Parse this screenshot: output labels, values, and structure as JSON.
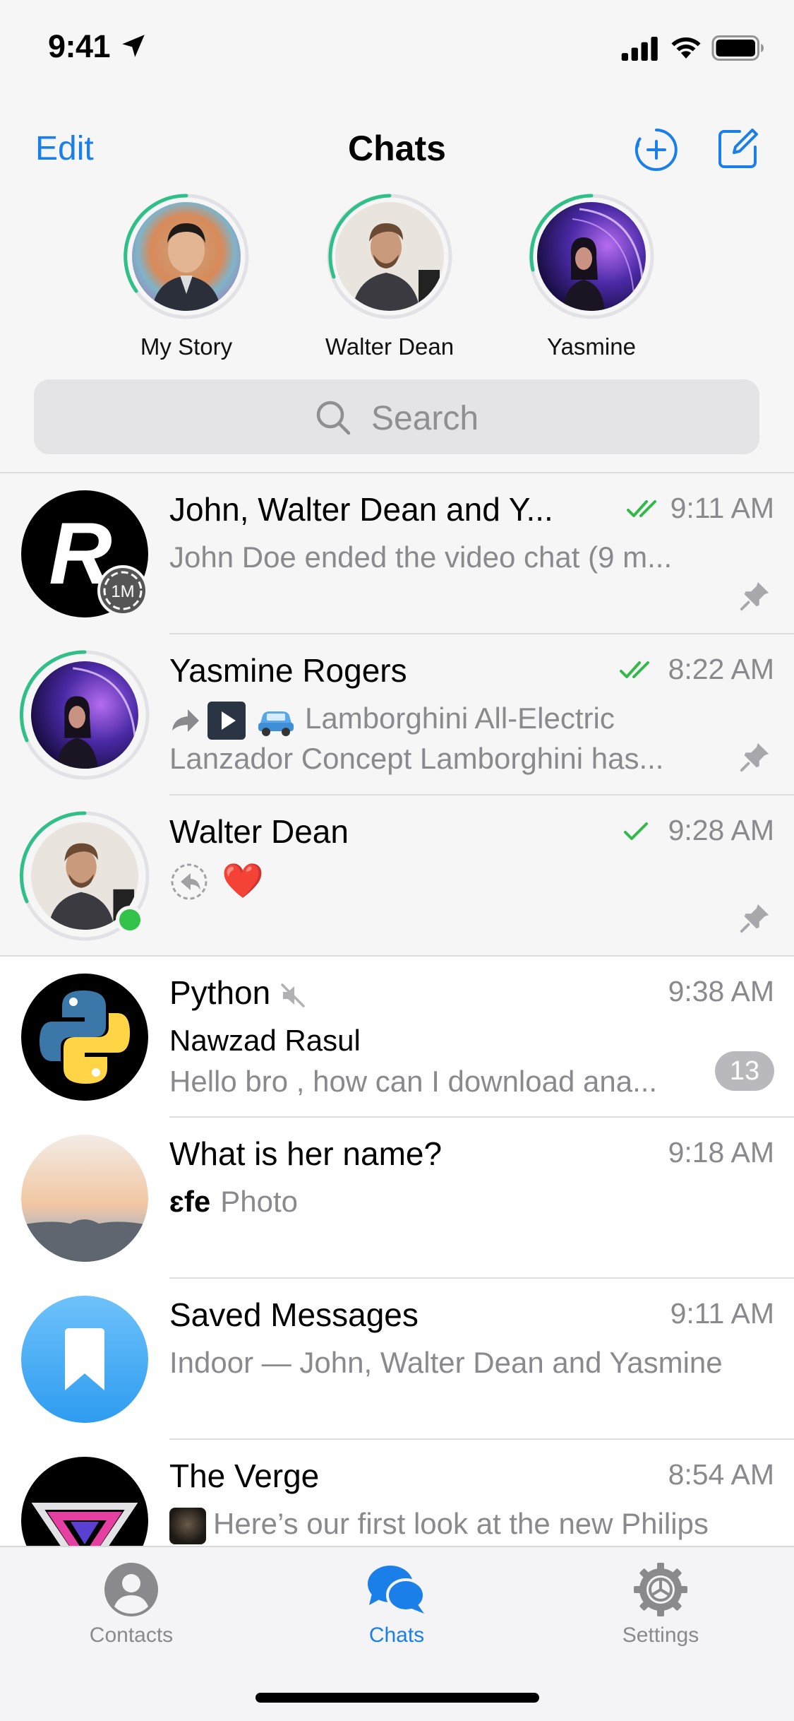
{
  "status_bar": {
    "time": "9:41"
  },
  "nav": {
    "edit_label": "Edit",
    "title": "Chats"
  },
  "stories": [
    {
      "name": "My Story"
    },
    {
      "name": "Walter Dean"
    },
    {
      "name": "Yasmine"
    }
  ],
  "search": {
    "placeholder": "Search"
  },
  "chats": [
    {
      "title": "John, Walter Dean and Y...",
      "time": "9:11 AM",
      "preview": "John Doe ended the video chat (9 m...",
      "avatar_letter": "R",
      "avatar_badge": "1M",
      "status": "read",
      "pinned": true
    },
    {
      "title": "Yasmine Rogers",
      "time": "8:22 AM",
      "preview_line1": "Lamborghini All-Electric",
      "preview_line2": "Lanzador Concept Lamborghini has...",
      "status": "read",
      "pinned": true
    },
    {
      "title": "Walter Dean",
      "time": "9:28 AM",
      "preview_emoji": "❤️",
      "status": "sent",
      "pinned": true,
      "online": true
    },
    {
      "title": "Python",
      "time": "9:38 AM",
      "sender": "Nawzad Rasul",
      "preview": "Hello bro , how can I download ana...",
      "unread": "13",
      "muted": true
    },
    {
      "title": "What is her name?",
      "time": "9:18 AM",
      "preview_prefix": "ɛfe",
      "preview": "Photo"
    },
    {
      "title": "Saved Messages",
      "time": "9:11 AM",
      "preview": "Indoor — John, Walter Dean and Yasmine"
    },
    {
      "title": "The Verge",
      "time": "8:54 AM",
      "preview": "Here’s our first look at the new Philips"
    }
  ],
  "tabs": [
    {
      "label": "Contacts",
      "icon": "person-circle-icon"
    },
    {
      "label": "Chats",
      "icon": "chat-bubbles-icon",
      "active": true
    },
    {
      "label": "Settings",
      "icon": "gear-icon"
    }
  ],
  "colors": {
    "accent": "#1a7fe8",
    "check_green": "#33b84a",
    "story_ring": "#2fc08a"
  }
}
